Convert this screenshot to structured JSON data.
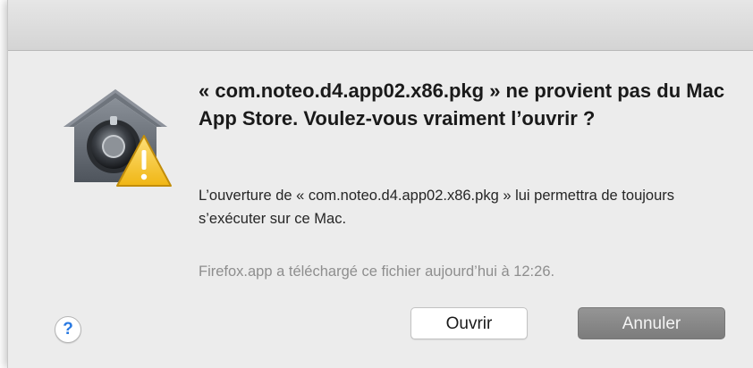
{
  "dialog": {
    "icon": "gatekeeper-warning-icon",
    "message": "« com.noteo.d4.app02.x86.pkg » ne provient pas du Mac App Store. Voulez-vous vraiment l’ouvrir ?",
    "info": "L’ouverture de « com.noteo.d4.app02.x86.pkg » lui permettra de toujours s’exécuter sur ce Mac.",
    "source": "Firefox.app a téléchargé ce fichier aujourd’hui à 12:26.",
    "buttons": {
      "open_label": "Ouvrir",
      "cancel_label": "Annuler"
    },
    "help_label": "?"
  },
  "colors": {
    "window_bg": "#ececec",
    "help_accent": "#2a7ae2",
    "warning_yellow": "#f7c520",
    "cancel_button": "#888888"
  }
}
